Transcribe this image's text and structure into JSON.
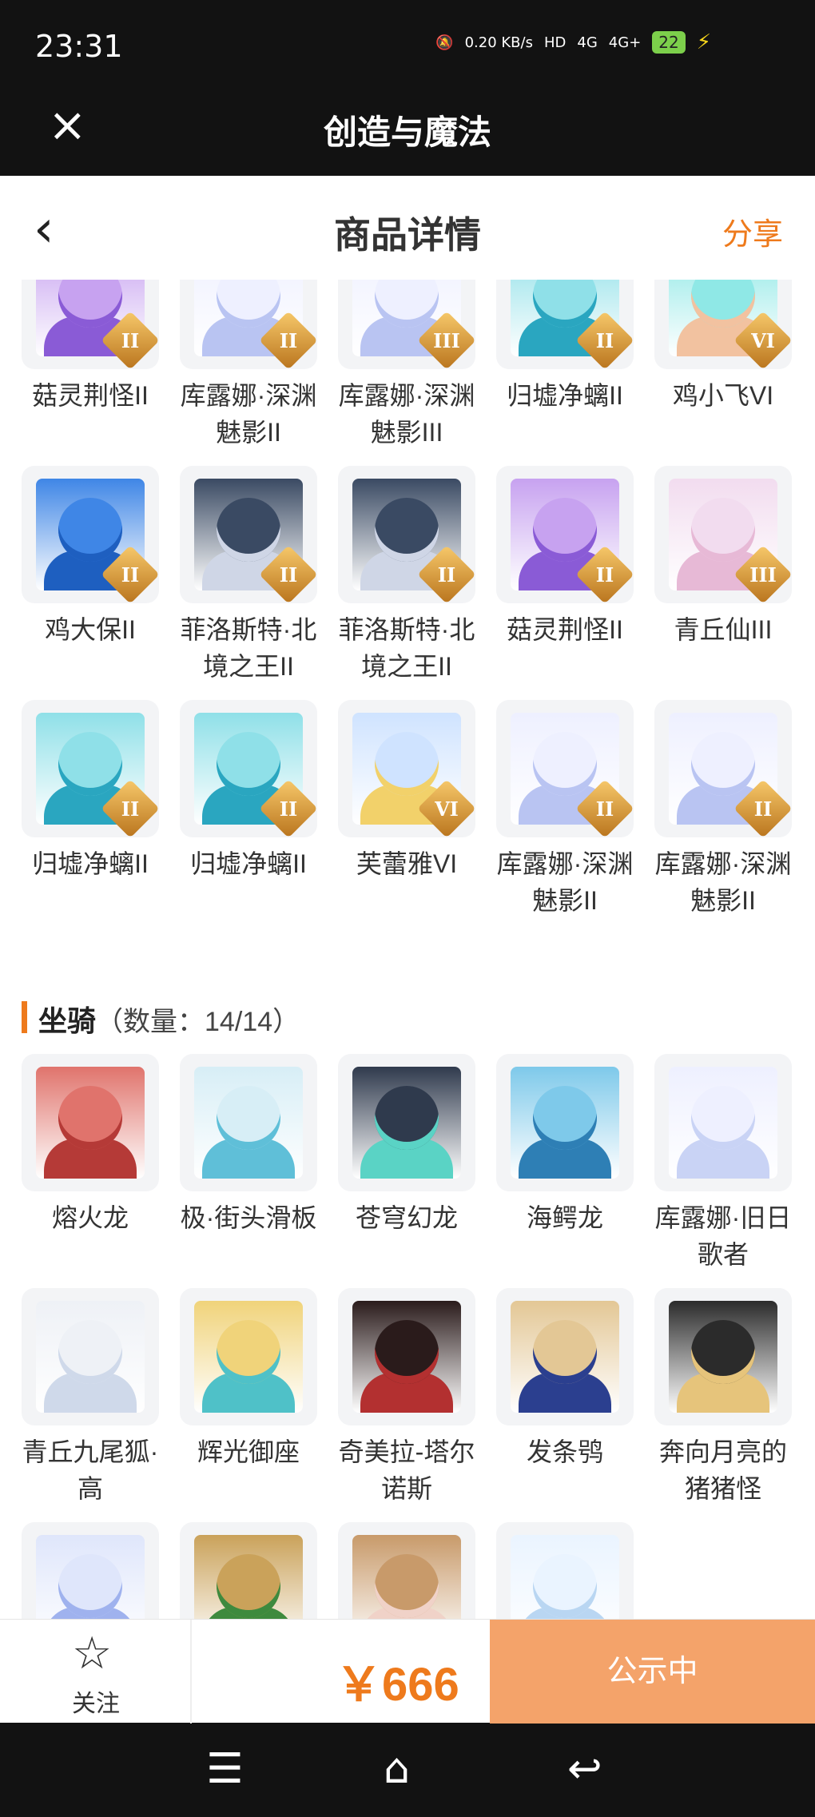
{
  "status": {
    "time": "23:31",
    "speed": "0.20 KB/s",
    "hd": "HD",
    "net1": "4G",
    "net2": "4G+",
    "battery": "22"
  },
  "app": {
    "title": "创造与魔法"
  },
  "page": {
    "title": "商品详情",
    "share": "分享"
  },
  "colors": {
    "accent": "#ee7a1c",
    "button": "#f4a36a"
  },
  "top_rows": [
    [
      {
        "label": "菇灵荆怪II",
        "badge": "II",
        "colors": [
          "#c7a2f0",
          "#8a5bd6"
        ]
      },
      {
        "label": "库露娜·深渊魅影II",
        "badge": "II",
        "colors": [
          "#eef0ff",
          "#b9c4f2"
        ]
      },
      {
        "label": "库露娜·深渊魅影III",
        "badge": "III",
        "colors": [
          "#eef0ff",
          "#b9c4f2"
        ]
      },
      {
        "label": "归墟净螭II",
        "badge": "II",
        "colors": [
          "#8fe0e8",
          "#2aa6c0"
        ]
      },
      {
        "label": "鸡小飞VI",
        "badge": "VI",
        "colors": [
          "#8fe8e6",
          "#f2c2a0"
        ]
      }
    ],
    [
      {
        "label": "鸡大保II",
        "badge": "II",
        "colors": [
          "#3f86e6",
          "#1e5fc0"
        ]
      },
      {
        "label": "菲洛斯特·北境之王II",
        "badge": "II",
        "colors": [
          "#3a4a63",
          "#cfd6e6"
        ]
      },
      {
        "label": "菲洛斯特·北境之王II",
        "badge": "II",
        "colors": [
          "#3a4a63",
          "#cfd6e6"
        ]
      },
      {
        "label": "菇灵荆怪II",
        "badge": "II",
        "colors": [
          "#c7a2f0",
          "#8a5bd6"
        ]
      },
      {
        "label": "青丘仙III",
        "badge": "III",
        "colors": [
          "#f2dcef",
          "#e7b9d6"
        ]
      }
    ],
    [
      {
        "label": "归墟净螭II",
        "badge": "II",
        "colors": [
          "#8fe0e8",
          "#2aa6c0"
        ]
      },
      {
        "label": "归墟净螭II",
        "badge": "II",
        "colors": [
          "#8fe0e8",
          "#2aa6c0"
        ]
      },
      {
        "label": "芙蕾雅VI",
        "badge": "VI",
        "colors": [
          "#cfe3ff",
          "#f2d16a"
        ]
      },
      {
        "label": "库露娜·深渊魅影II",
        "badge": "II",
        "colors": [
          "#eef0ff",
          "#b9c4f2"
        ]
      },
      {
        "label": "库露娜·深渊魅影II",
        "badge": "II",
        "colors": [
          "#eef0ff",
          "#b9c4f2"
        ]
      }
    ]
  ],
  "mount_section": {
    "title": "坐骑",
    "count": "（数量：14/14）"
  },
  "mount_rows": [
    [
      {
        "label": "熔火龙",
        "colors": [
          "#e0736c",
          "#b53a37"
        ]
      },
      {
        "label": "极·街头滑板",
        "colors": [
          "#d7eef6",
          "#5fbfd8"
        ]
      },
      {
        "label": "苍穹幻龙",
        "colors": [
          "#2f3a4d",
          "#5ad3c5"
        ]
      },
      {
        "label": "海鳄龙",
        "colors": [
          "#7ec9ea",
          "#2e7fb5"
        ]
      },
      {
        "label": "库露娜·旧日歌者",
        "colors": [
          "#eef0ff",
          "#c9d3f5"
        ]
      }
    ],
    [
      {
        "label": "青丘九尾狐·高",
        "colors": [
          "#eef1f6",
          "#cfd9ea"
        ]
      },
      {
        "label": "辉光御座",
        "colors": [
          "#f0d37a",
          "#4fc1c8"
        ]
      },
      {
        "label": "奇美拉-塔尔诺斯",
        "colors": [
          "#2a1b1b",
          "#b33030"
        ]
      },
      {
        "label": "发条鸮",
        "colors": [
          "#e3c795",
          "#2b3f8f"
        ]
      },
      {
        "label": "奔向月亮的猪猪怪",
        "colors": [
          "#2b2b2b",
          "#e6c47b"
        ]
      }
    ],
    [
      {
        "label": "",
        "colors": [
          "#dfe6fb",
          "#9fb2ee"
        ]
      },
      {
        "label": "",
        "colors": [
          "#caa25a",
          "#3e8a3e"
        ]
      },
      {
        "label": "",
        "colors": [
          "#c89a6a",
          "#f0d2c8"
        ]
      },
      {
        "label": "",
        "colors": [
          "#eaf4ff",
          "#b9d6f2"
        ]
      }
    ]
  ],
  "bottom": {
    "follow": "关注",
    "price": "￥666",
    "status": "公示中"
  }
}
